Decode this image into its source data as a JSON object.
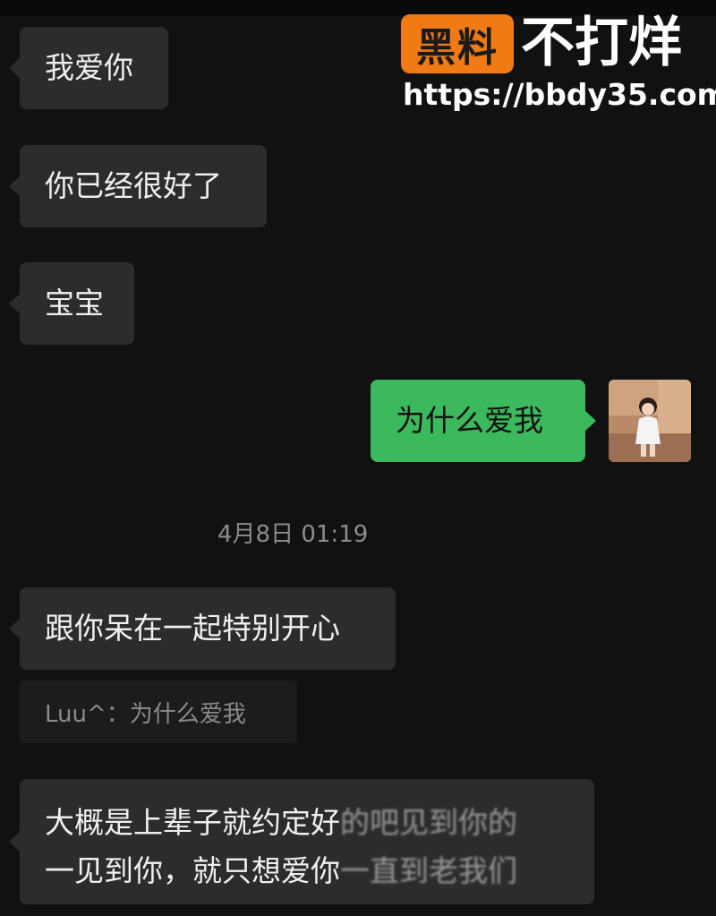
{
  "messages": [
    {
      "side": "left",
      "text": "我爱你"
    },
    {
      "side": "left",
      "text": "你已经很好了"
    },
    {
      "side": "left",
      "text": "宝宝"
    },
    {
      "side": "right",
      "text": "为什么爱我"
    },
    {
      "side": "left",
      "text": "跟你呆在一起特别开心"
    },
    {
      "side": "left",
      "line1": "大概是上辈子就约定好",
      "line1_obscured": "的吧见到你的",
      "line2": "一见到你，就只想爱你",
      "line2_obscured": "一直到老我们"
    }
  ],
  "timestamp": "4月8日 01:19",
  "quote": {
    "text": "Luu^：为什么爱我"
  },
  "watermark": {
    "badge": "黑料",
    "title": "不打烊",
    "url": "https://bbdy35.com"
  },
  "colors": {
    "background": "#111111",
    "bubble_incoming": "#2c2c2c",
    "bubble_outgoing": "#3cb95d",
    "watermark_accent": "#f07a14"
  },
  "icons": {
    "avatar": "child-photo-avatar"
  }
}
